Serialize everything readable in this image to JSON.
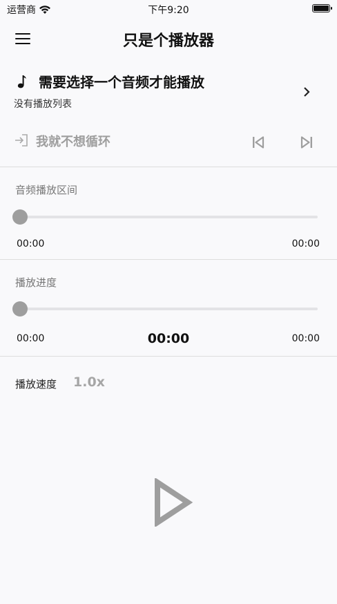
{
  "status_bar": {
    "carrier": "运营商",
    "time": "下午9:20"
  },
  "app_bar": {
    "title": "只是个播放器",
    "menu_icon": "menu-icon"
  },
  "track": {
    "title": "需要选择一个音频才能播放",
    "subtitle": "没有播放列表",
    "icon": "music-note-icon",
    "chevron": "chevron-right-icon"
  },
  "controls": {
    "loop_label": "我就不想循环",
    "loop_icon": "enter-icon",
    "prev_icon": "skip-previous-icon",
    "next_icon": "skip-next-icon"
  },
  "range_section": {
    "label": "音频播放区间",
    "start": "00:00",
    "end": "00:00",
    "value": 0
  },
  "progress_section": {
    "label": "播放进度",
    "start": "00:00",
    "current": "00:00",
    "end": "00:00",
    "value": 0
  },
  "speed": {
    "label": "播放速度",
    "value": "1.0x"
  },
  "play_button": {
    "icon": "play-icon"
  },
  "colors": {
    "background": "#f9f9fb",
    "disabled": "#9e9e9e",
    "divider": "#dddddd"
  }
}
